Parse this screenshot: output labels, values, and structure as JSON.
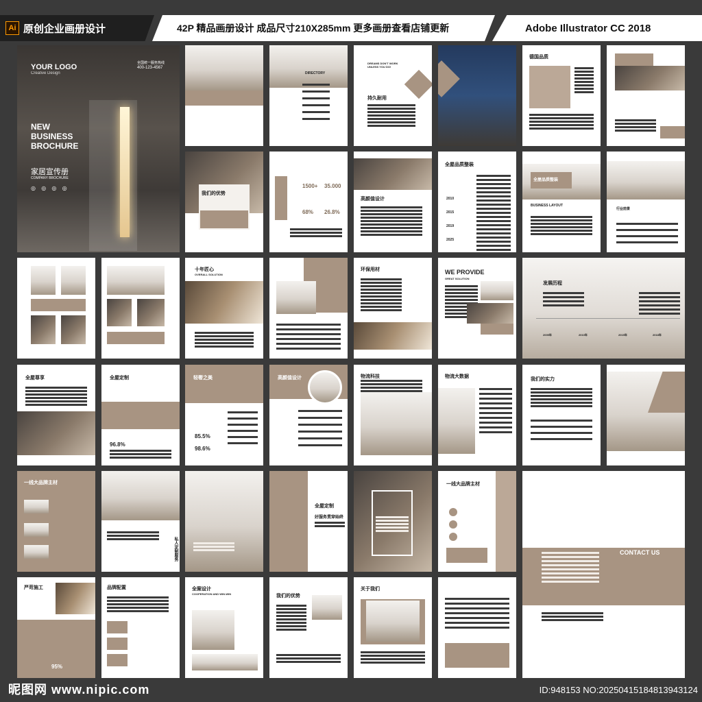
{
  "header": {
    "left": "原创企业画册设计",
    "ai_badge": "Ai",
    "center": "42P 精品画册设计 成品尺寸210X285mm 更多画册查看店铺更新",
    "right": "Adobe Illustrator CC 2018"
  },
  "cover": {
    "logo": "YOUR LOGO",
    "logo_sub": "Creative Design",
    "phone_label": "全国统一服务热线",
    "phone": "400-123-4567",
    "title_line1": "NEW",
    "title_line2": "BUSINESS",
    "title_line3": "BROCHURE",
    "cn_title": "家居宣传册",
    "en_sub": "COMPANY BROCHURE"
  },
  "pages": {
    "p_directory": "DIRECTORY",
    "p_dreams": "DREAMS DON'T WORK UNLESS YOU DO!",
    "p_durable": "持久耐用",
    "p_brand": "德国品质",
    "p_advantage": "我们的优势",
    "p_design": "高颜值设计",
    "p_whole": "全屋品质整装",
    "p_full_design": "全屋品质整装",
    "p_business": "BUSINESS LAYOUT",
    "p_industry": "行业前景",
    "p_ten_years": "十年匠心",
    "p_overall": "OVERALL SOLUTION",
    "p_eco": "环保用材",
    "p_we_provide": "WE PROVIDE",
    "p_great": "GREAT SOLUTION",
    "p_history": "发展历程",
    "p_respect": "全屋尊享",
    "p_custom": "全屋定制",
    "p_light": "轻奢之美",
    "p_high_design": "高颜值设计",
    "p_logistics": "物流科技",
    "p_bigdata": "物流大数据",
    "p_strength": "我们的实力",
    "p_brand_main": "一线大品牌主材",
    "p_private": "私人定制服务",
    "p_custom2": "全屋定制",
    "p_service": "好服务贯穿始终",
    "p_brand_main2": "一线大品牌主材",
    "p_contact": "CONTACT US",
    "p_craft": "严苛施工",
    "p_config": "品牌配置",
    "p_win": "全案设计",
    "p_coop": "COOPERATION AND WIN-WIN",
    "p_advantage2": "我们的优势",
    "p_about": "关于我们",
    "stat_1": "1500+",
    "stat_2": "35.000",
    "stat_3": "68%",
    "stat_4": "26.8%",
    "stat_5": "96.8%",
    "stat_6": "85.5%",
    "stat_7": "98.6%",
    "stat_8": "95%",
    "years": [
      "2010",
      "2015",
      "2019",
      "2025"
    ],
    "tl_years": [
      "2005年",
      "2010年",
      "2015年",
      "2018年"
    ]
  },
  "footer": {
    "site": "昵图网 www.nipic.com",
    "id": "ID:948153 NO:20250415184813943124"
  }
}
